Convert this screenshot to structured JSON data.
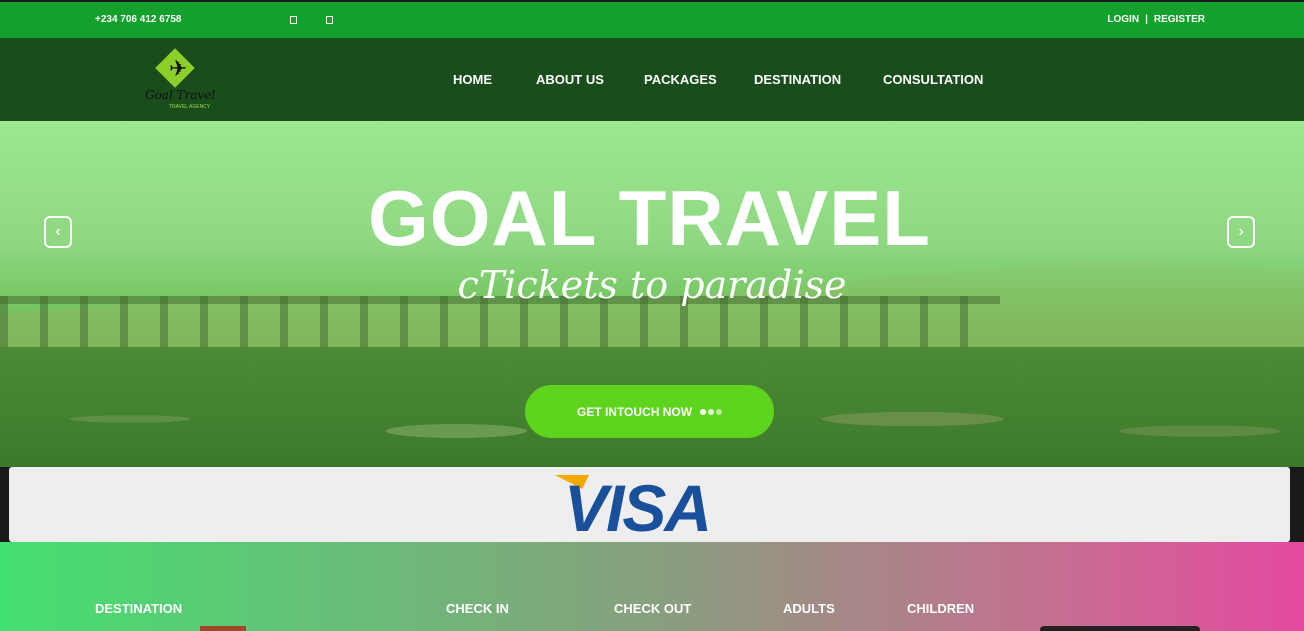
{
  "topbar": {
    "phone": "+234 706 412 6758",
    "login": "LOGIN",
    "separator": "|",
    "register": "REGISTER"
  },
  "brand": {
    "name": "Goal Travel",
    "subtitle": "TRAVEL AGENCY"
  },
  "nav": {
    "items": [
      "HOME",
      "ABOUT US",
      "PACKAGES",
      "DESTINATION",
      "CONSULTATION"
    ]
  },
  "hero": {
    "title": "GOAL TRAVEL",
    "tagline": "cTickets to paradise",
    "cta_label": "GET INTOUCH NOW",
    "prev_icon": "‹",
    "next_icon": "›"
  },
  "partner": {
    "logo_text": "VISA"
  },
  "search": {
    "fields": [
      "DESTINATION",
      "CHECK IN",
      "CHECK OUT",
      "ADULTS",
      "CHILDREN"
    ]
  },
  "colors": {
    "topbar": "#14a02c",
    "nav": "#1a4d1c",
    "cta": "#5fd41f",
    "visa_blue": "#1a4f9c"
  }
}
